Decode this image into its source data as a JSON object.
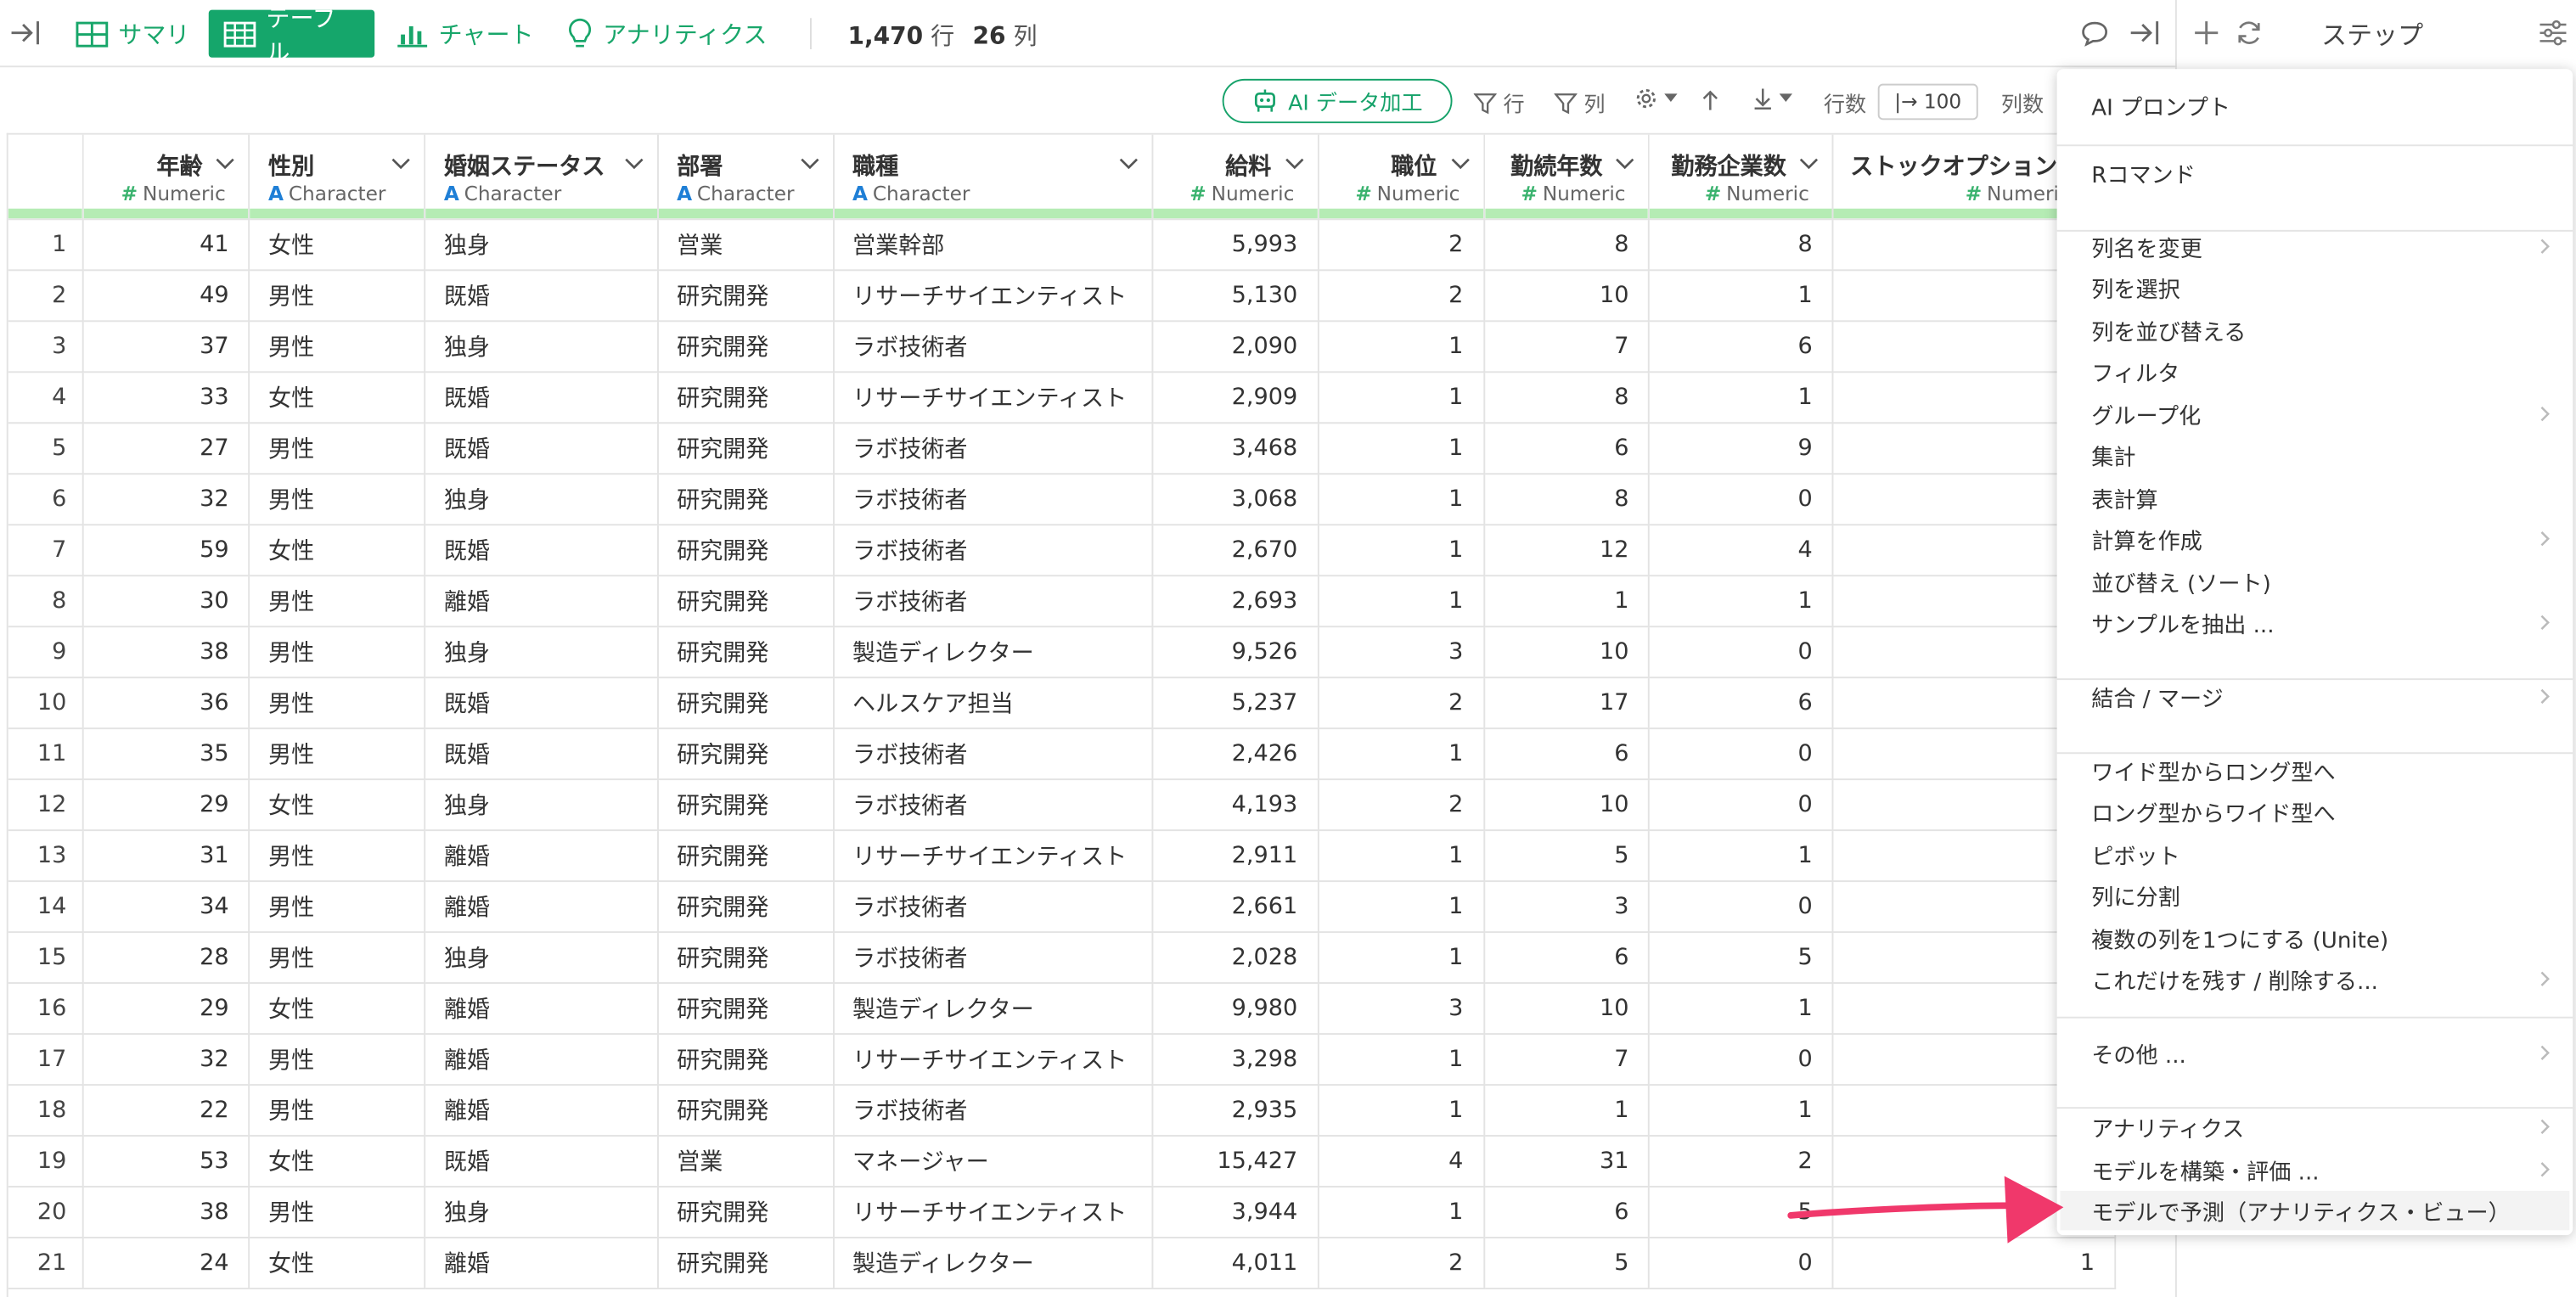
{
  "toolbar": {
    "tabs": [
      "サマリ",
      "テーブル",
      "チャート",
      "アナリティクス"
    ],
    "rows_value": "1,470",
    "rows_unit": "行",
    "cols_value": "26",
    "cols_unit": "列"
  },
  "steps_panel": {
    "title": "ステップ"
  },
  "subbar": {
    "ai_label": "AI データ加工",
    "row_filter": "行",
    "col_filter": "列",
    "rows_label": "行数",
    "rows_input": "|→ 100",
    "cols_label": "列数"
  },
  "table": {
    "columns": [
      {
        "name": "年齢",
        "type": "Numeric"
      },
      {
        "name": "性別",
        "type": "Character"
      },
      {
        "name": "婚姻ステータス",
        "type": "Character"
      },
      {
        "name": "部署",
        "type": "Character"
      },
      {
        "name": "職種",
        "type": "Character"
      },
      {
        "name": "給料",
        "type": "Numeric"
      },
      {
        "name": "職位",
        "type": "Numeric"
      },
      {
        "name": "勤続年数",
        "type": "Numeric"
      },
      {
        "name": "勤務企業数",
        "type": "Numeric"
      },
      {
        "name": "ストックオプション",
        "type": "Numeric"
      }
    ],
    "rows": [
      [
        "1",
        "41",
        "女性",
        "独身",
        "営業",
        "営業幹部",
        "5,993",
        "2",
        "8",
        "8",
        ""
      ],
      [
        "2",
        "49",
        "男性",
        "既婚",
        "研究開発",
        "リサーチサイエンティスト",
        "5,130",
        "2",
        "10",
        "1",
        ""
      ],
      [
        "3",
        "37",
        "男性",
        "独身",
        "研究開発",
        "ラボ技術者",
        "2,090",
        "1",
        "7",
        "6",
        ""
      ],
      [
        "4",
        "33",
        "女性",
        "既婚",
        "研究開発",
        "リサーチサイエンティスト",
        "2,909",
        "1",
        "8",
        "1",
        ""
      ],
      [
        "5",
        "27",
        "男性",
        "既婚",
        "研究開発",
        "ラボ技術者",
        "3,468",
        "1",
        "6",
        "9",
        ""
      ],
      [
        "6",
        "32",
        "男性",
        "独身",
        "研究開発",
        "ラボ技術者",
        "3,068",
        "1",
        "8",
        "0",
        ""
      ],
      [
        "7",
        "59",
        "女性",
        "既婚",
        "研究開発",
        "ラボ技術者",
        "2,670",
        "1",
        "12",
        "4",
        ""
      ],
      [
        "8",
        "30",
        "男性",
        "離婚",
        "研究開発",
        "ラボ技術者",
        "2,693",
        "1",
        "1",
        "1",
        ""
      ],
      [
        "9",
        "38",
        "男性",
        "独身",
        "研究開発",
        "製造ディレクター",
        "9,526",
        "3",
        "10",
        "0",
        ""
      ],
      [
        "10",
        "36",
        "男性",
        "既婚",
        "研究開発",
        "ヘルスケア担当",
        "5,237",
        "2",
        "17",
        "6",
        ""
      ],
      [
        "11",
        "35",
        "男性",
        "既婚",
        "研究開発",
        "ラボ技術者",
        "2,426",
        "1",
        "6",
        "0",
        ""
      ],
      [
        "12",
        "29",
        "女性",
        "独身",
        "研究開発",
        "ラボ技術者",
        "4,193",
        "2",
        "10",
        "0",
        ""
      ],
      [
        "13",
        "31",
        "男性",
        "離婚",
        "研究開発",
        "リサーチサイエンティスト",
        "2,911",
        "1",
        "5",
        "1",
        ""
      ],
      [
        "14",
        "34",
        "男性",
        "離婚",
        "研究開発",
        "ラボ技術者",
        "2,661",
        "1",
        "3",
        "0",
        ""
      ],
      [
        "15",
        "28",
        "男性",
        "独身",
        "研究開発",
        "ラボ技術者",
        "2,028",
        "1",
        "6",
        "5",
        ""
      ],
      [
        "16",
        "29",
        "女性",
        "離婚",
        "研究開発",
        "製造ディレクター",
        "9,980",
        "3",
        "10",
        "1",
        ""
      ],
      [
        "17",
        "32",
        "男性",
        "離婚",
        "研究開発",
        "リサーチサイエンティスト",
        "3,298",
        "1",
        "7",
        "0",
        ""
      ],
      [
        "18",
        "22",
        "男性",
        "離婚",
        "研究開発",
        "ラボ技術者",
        "2,935",
        "1",
        "1",
        "1",
        ""
      ],
      [
        "19",
        "53",
        "女性",
        "既婚",
        "営業",
        "マネージャー",
        "15,427",
        "4",
        "31",
        "2",
        ""
      ],
      [
        "20",
        "38",
        "男性",
        "独身",
        "研究開発",
        "リサーチサイエンティスト",
        "3,944",
        "1",
        "6",
        "5",
        ""
      ],
      [
        "21",
        "24",
        "女性",
        "離婚",
        "研究開発",
        "製造ディレクター",
        "4,011",
        "2",
        "5",
        "0",
        "1"
      ]
    ]
  },
  "menu": {
    "items": [
      {
        "label": "AI プロンプト",
        "sub": false
      },
      {
        "label": "Rコマンド",
        "sub": false
      },
      {
        "label": "列名を変更",
        "sub": true
      },
      {
        "label": "列を選択",
        "sub": false
      },
      {
        "label": "列を並び替える",
        "sub": false
      },
      {
        "label": "フィルタ",
        "sub": false
      },
      {
        "label": "グループ化",
        "sub": true
      },
      {
        "label": "集計",
        "sub": false
      },
      {
        "label": "表計算",
        "sub": false
      },
      {
        "label": "計算を作成",
        "sub": true
      },
      {
        "label": "並び替え (ソート)",
        "sub": false
      },
      {
        "label": "サンプルを抽出 ...",
        "sub": true
      },
      {
        "label": "結合 / マージ",
        "sub": true
      },
      {
        "label": "ワイド型からロング型へ",
        "sub": false
      },
      {
        "label": "ロング型からワイド型へ",
        "sub": false
      },
      {
        "label": "ピボット",
        "sub": false
      },
      {
        "label": "列に分割",
        "sub": false
      },
      {
        "label": "複数の列を1つにする (Unite)",
        "sub": false
      },
      {
        "label": "これだけを残す / 削除する...",
        "sub": true
      },
      {
        "label": "その他 ...",
        "sub": true
      },
      {
        "label": "アナリティクス",
        "sub": true
      },
      {
        "label": "モデルを構築・評価 ...",
        "sub": true
      },
      {
        "label": "モデルで予測（アナリティクス・ビュー）",
        "sub": false
      }
    ]
  },
  "colors": {
    "accent": "#15a66b",
    "header_underline": "#b5ecb4",
    "pointer_arrow": "#f0386b",
    "menu_highlight": "#f3f3f3"
  }
}
